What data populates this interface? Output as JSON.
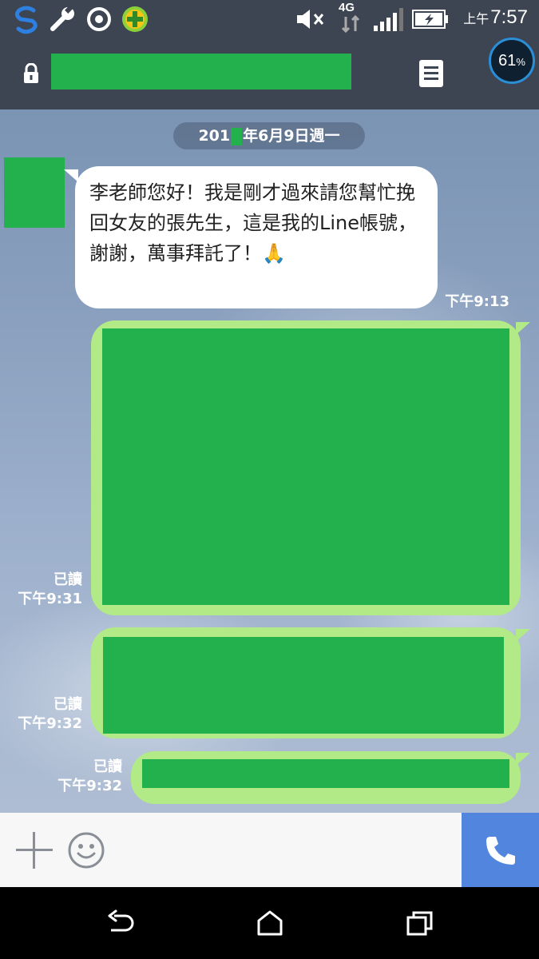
{
  "status_bar": {
    "network_type": "4G",
    "time_period": "上午",
    "time": "7:57",
    "icons": [
      "app-s-icon",
      "wrench-icon",
      "record-icon",
      "plus-app-icon",
      "mute-icon",
      "network-arrows-icon",
      "signal-icon",
      "battery-charging-icon"
    ]
  },
  "header": {
    "battery_badge_value": "61",
    "battery_badge_unit": "%"
  },
  "chat": {
    "date_prefix": "201",
    "date_suffix": "年6月9日週一",
    "incoming": {
      "text": "李老師您好！我是剛才過來請您幫忙挽回女友的張先生，這是我的Line帳號，謝謝，萬事拜託了！🙏",
      "time": "下午9:13"
    },
    "outgoing": [
      {
        "read_label": "已讀",
        "time": "下午9:31"
      },
      {
        "read_label": "已讀",
        "time": "下午9:32"
      },
      {
        "read_label": "已讀",
        "time": "下午9:32"
      }
    ]
  },
  "colors": {
    "header_bg": "#3d4553",
    "outgoing_bubble": "#b1ea86",
    "redaction": "#22b14c",
    "call_button": "#5286de"
  }
}
